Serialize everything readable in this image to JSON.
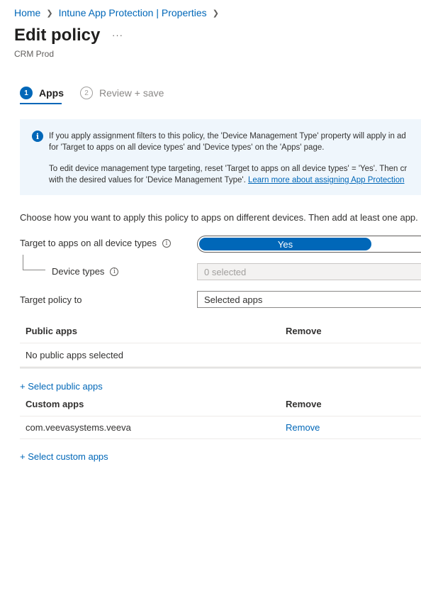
{
  "breadcrumb": {
    "items": [
      "Home",
      "Intune App Protection | Properties"
    ]
  },
  "header": {
    "title": "Edit policy",
    "more": "···",
    "subtitle": "CRM Prod"
  },
  "wizard": {
    "steps": [
      {
        "number": "1",
        "label": "Apps",
        "active": true
      },
      {
        "number": "2",
        "label": "Review + save",
        "active": false
      }
    ]
  },
  "info_banner": {
    "icon": "info-icon",
    "line1": "If you apply assignment filters to this policy, the 'Device Management Type' property will apply in ad",
    "line2": "for 'Target to apps on all device types' and 'Device types' on the 'Apps' page.",
    "line3": "To edit device management type targeting, reset 'Target to apps on all device types' = 'Yes'. Then cr",
    "line4_prefix": "with the desired values for 'Device Management Type'. ",
    "link": "Learn more about assigning App Protection"
  },
  "instructions": "Choose how you want to apply this policy to apps on different devices. Then add at least one app.",
  "form": {
    "target_all_label": "Target to apps on all device types",
    "target_all_value": "Yes",
    "device_types_label": "Device types",
    "device_types_value": "0 selected",
    "target_policy_label": "Target policy to",
    "target_policy_value": "Selected apps"
  },
  "public_apps": {
    "columns": [
      "Public apps",
      "Remove"
    ],
    "empty_text": "No public apps selected",
    "add_link": "+ Select public apps"
  },
  "custom_apps": {
    "columns": [
      "Custom apps",
      "Remove"
    ],
    "rows": [
      {
        "app": "com.veevasystems.veeva",
        "action": "Remove"
      }
    ],
    "add_link": "+ Select custom apps"
  },
  "colors": {
    "accent": "#0067b8",
    "info_background": "#eff6fc"
  }
}
